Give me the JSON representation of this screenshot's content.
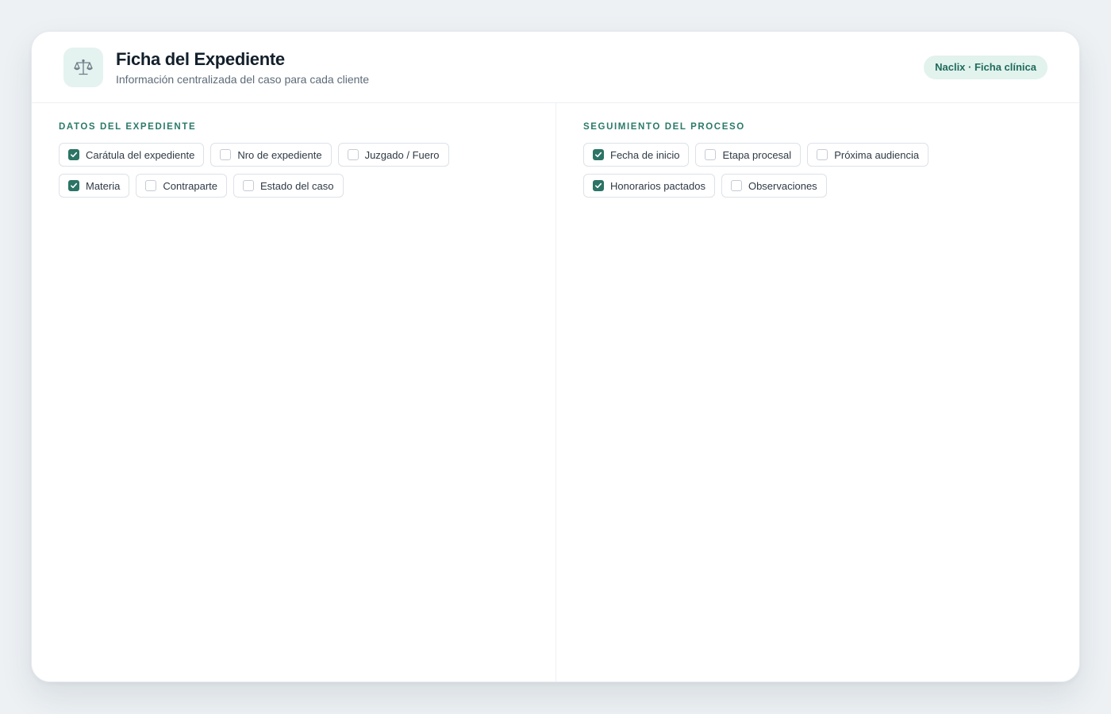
{
  "header": {
    "title": "Ficha del Expediente",
    "subtitle": "Información centralizada del caso para cada cliente",
    "badge": "Naclix · Ficha clínica",
    "logo_icon": "balance-scale-icon"
  },
  "sections": [
    {
      "title": "DATOS DEL EXPEDIENTE",
      "items": [
        {
          "label": "Carátula del expediente",
          "checked": true
        },
        {
          "label": "Nro de expediente",
          "checked": false
        },
        {
          "label": "Juzgado / Fuero",
          "checked": false
        },
        {
          "label": "Materia",
          "checked": true
        },
        {
          "label": "Contraparte",
          "checked": false
        },
        {
          "label": "Estado del caso",
          "checked": false
        }
      ]
    },
    {
      "title": "SEGUIMIENTO DEL PROCESO",
      "items": [
        {
          "label": "Fecha de inicio",
          "checked": true
        },
        {
          "label": "Etapa procesal",
          "checked": false
        },
        {
          "label": "Próxima audiencia",
          "checked": false
        },
        {
          "label": "Honorarios pactados",
          "checked": true
        },
        {
          "label": "Observaciones",
          "checked": false
        }
      ]
    }
  ],
  "colors": {
    "accent": "#2b7466",
    "badge_bg": "#e2f2ed",
    "logo_bg": "#e4f3ef"
  }
}
